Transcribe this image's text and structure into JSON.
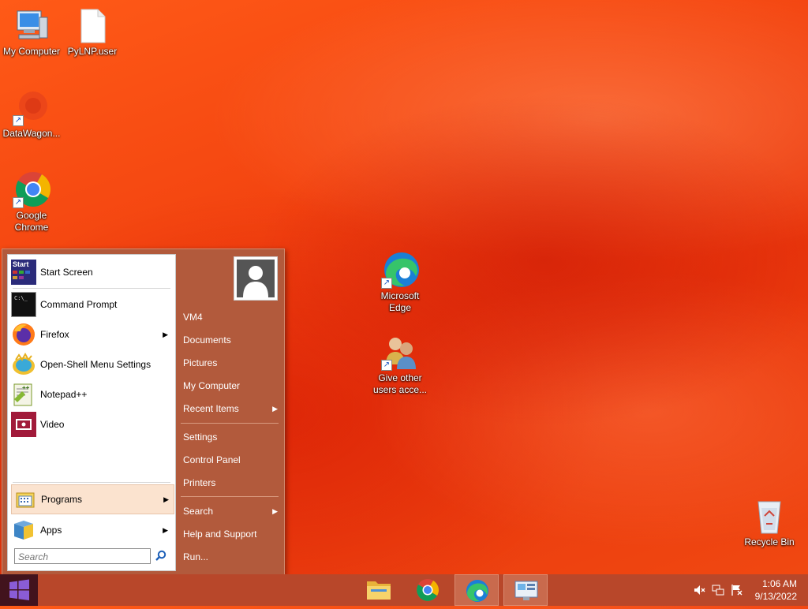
{
  "desktop": {
    "icons": [
      {
        "label": "My Computer"
      },
      {
        "label": "PyLNP.user"
      },
      {
        "label": "DataWagon..."
      },
      {
        "label": "Google Chrome"
      },
      {
        "label": "Microsoft Edge"
      },
      {
        "label": "Give other users acce..."
      },
      {
        "label": "Recycle Bin"
      }
    ]
  },
  "start_menu": {
    "left": {
      "items": [
        {
          "label": "Start Screen",
          "icon_text": "Start"
        },
        {
          "label": "Command Prompt",
          "icon_text": "C:\\_"
        },
        {
          "label": "Firefox"
        },
        {
          "label": "Open-Shell Menu Settings"
        },
        {
          "label": "Notepad++",
          "icon_text": "++"
        },
        {
          "label": "Video"
        }
      ],
      "programs_label": "Programs",
      "apps_label": "Apps",
      "search_placeholder": "Search"
    },
    "right": {
      "items": [
        {
          "label": "VM4"
        },
        {
          "label": "Documents"
        },
        {
          "label": "Pictures"
        },
        {
          "label": "My Computer"
        },
        {
          "label": "Recent Items"
        },
        {
          "label": "Settings"
        },
        {
          "label": "Control Panel"
        },
        {
          "label": "Printers"
        },
        {
          "label": "Search"
        },
        {
          "label": "Help and Support"
        },
        {
          "label": "Run..."
        }
      ]
    }
  },
  "taskbar": {
    "clock_time": "1:06 AM",
    "clock_date": "9/13/2022"
  },
  "colors": {
    "accent": "#b8472a",
    "menu_right": "#b25a3c",
    "start_button": "#42131d"
  }
}
